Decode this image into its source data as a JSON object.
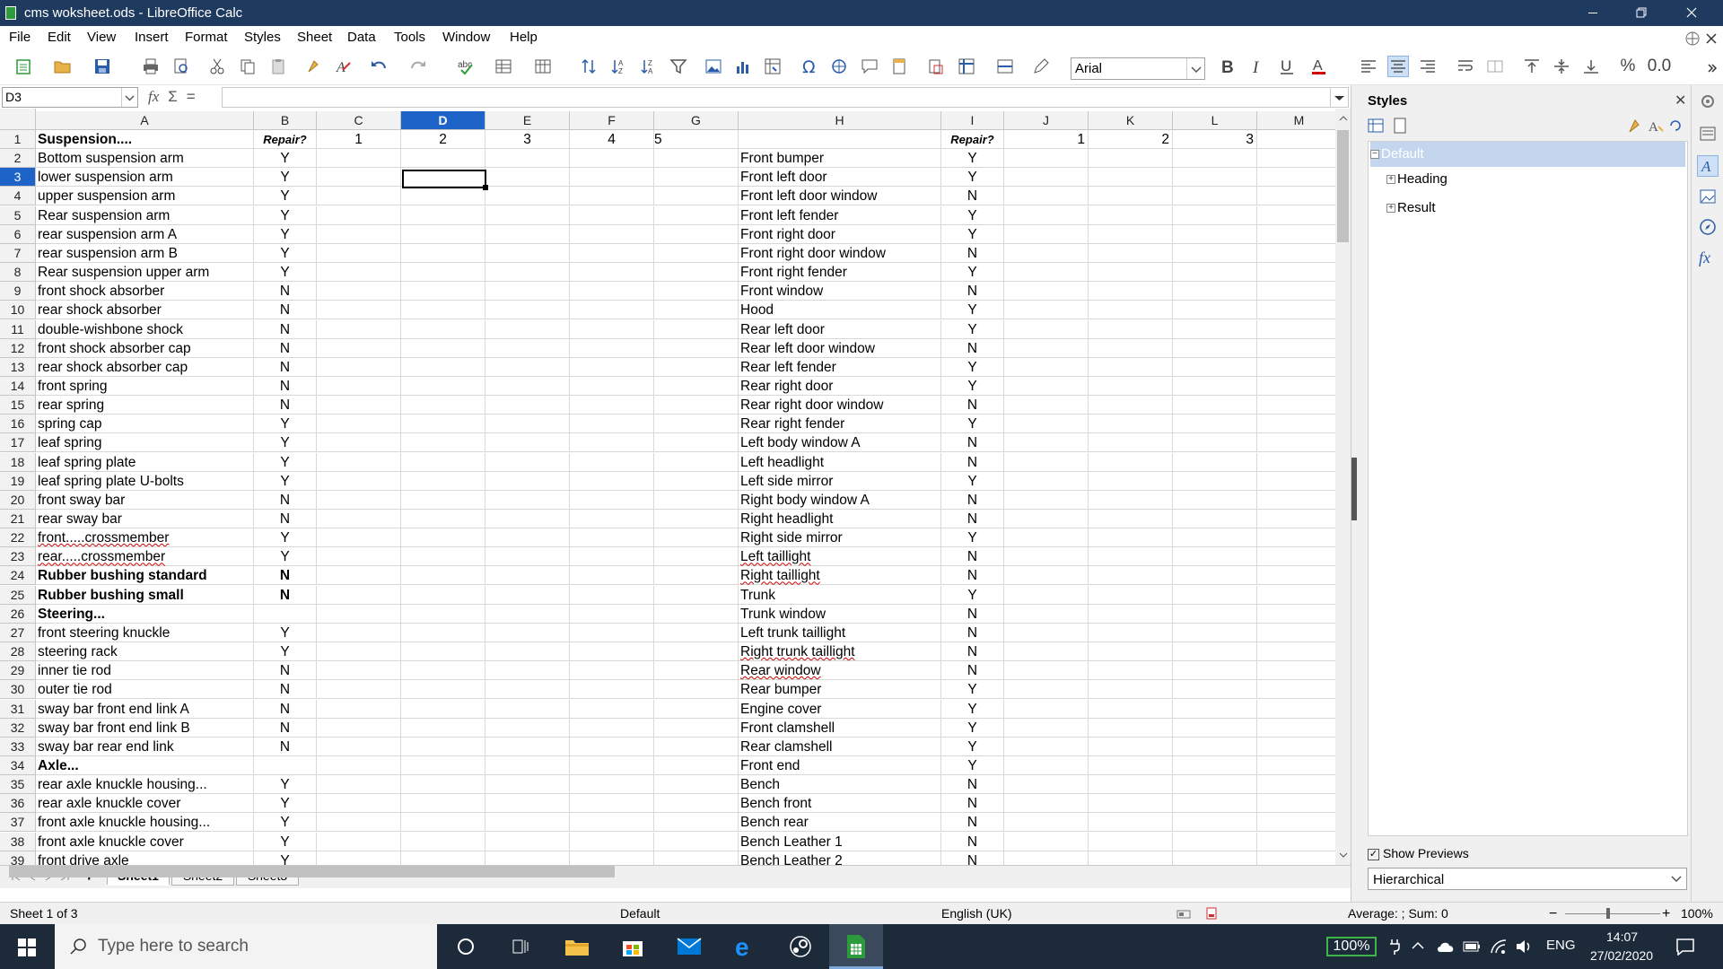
{
  "window": {
    "title": "cms woksheet.ods - LibreOffice Calc"
  },
  "menu": [
    "File",
    "Edit",
    "View",
    "Insert",
    "Format",
    "Styles",
    "Sheet",
    "Data",
    "Tools",
    "Window",
    "Help"
  ],
  "toolbar": {
    "font_name": "Arial",
    "percent_label": "%",
    "decimal_label": "0.0"
  },
  "formula_bar": {
    "cell_ref": "D3",
    "fx": "fx",
    "sigma": "Σ",
    "equals": "=",
    "content": ""
  },
  "columns": [
    "A",
    "B",
    "C",
    "D",
    "E",
    "F",
    "G",
    "H",
    "I",
    "J",
    "K",
    "L",
    "M"
  ],
  "selected_column": "D",
  "selected_row": 3,
  "rows": [
    {
      "n": 1,
      "a": "Suspension....",
      "b": "Repair?",
      "c": "1",
      "d": "2",
      "e": "3",
      "f": "4",
      "g": "5",
      "h": "",
      "i": "Repair?",
      "j": "1",
      "k": "2",
      "l": "3"
    },
    {
      "n": 2,
      "a": "Bottom suspension arm",
      "b": "Y",
      "h": "Front bumper",
      "i": "Y"
    },
    {
      "n": 3,
      "a": "lower suspension arm",
      "b": "Y",
      "h": "Front left door",
      "i": "Y"
    },
    {
      "n": 4,
      "a": "upper suspension arm",
      "b": "Y",
      "h": "Front left door window",
      "i": "N"
    },
    {
      "n": 5,
      "a": "Rear suspension arm",
      "b": "Y",
      "h": "Front left fender",
      "i": "Y"
    },
    {
      "n": 6,
      "a": "rear suspension arm A",
      "b": "Y",
      "h": "Front right door",
      "i": "Y"
    },
    {
      "n": 7,
      "a": "rear suspension arm B",
      "b": "Y",
      "h": "Front right door window",
      "i": "N"
    },
    {
      "n": 8,
      "a": "Rear suspension upper arm",
      "b": "Y",
      "h": "Front right fender",
      "i": "Y"
    },
    {
      "n": 9,
      "a": "front shock absorber",
      "b": "N",
      "h": "Front window",
      "i": "N"
    },
    {
      "n": 10,
      "a": "rear shock absorber",
      "b": "N",
      "h": "Hood",
      "i": "Y"
    },
    {
      "n": 11,
      "a": "double-wishbone shock",
      "b": "N",
      "h": "Rear left door",
      "i": "Y"
    },
    {
      "n": 12,
      "a": "front shock absorber cap",
      "b": "N",
      "h": "Rear left door window",
      "i": "N"
    },
    {
      "n": 13,
      "a": "rear shock absorber cap",
      "b": "N",
      "h": "Rear left fender",
      "i": "Y"
    },
    {
      "n": 14,
      "a": "front spring",
      "b": "N",
      "h": "Rear right door",
      "i": "Y"
    },
    {
      "n": 15,
      "a": "rear spring",
      "b": "N",
      "h": "Rear right door window",
      "i": "N"
    },
    {
      "n": 16,
      "a": "spring cap",
      "b": "Y",
      "h": "Rear right fender",
      "i": "Y"
    },
    {
      "n": 17,
      "a": "leaf spring",
      "b": "Y",
      "h": "Left body window A",
      "i": "N"
    },
    {
      "n": 18,
      "a": "leaf spring plate",
      "b": "Y",
      "h": "Left headlight",
      "i": "N"
    },
    {
      "n": 19,
      "a": "leaf spring plate U-bolts",
      "b": "Y",
      "h": "Left side mirror",
      "i": "Y"
    },
    {
      "n": 20,
      "a": "front sway bar",
      "b": "N",
      "h": "Right body window A",
      "i": "N"
    },
    {
      "n": 21,
      "a": "rear sway bar",
      "b": "N",
      "h": "Right headlight",
      "i": "N"
    },
    {
      "n": 22,
      "a": "front.....crossmember",
      "b": "Y",
      "h": "Right side mirror",
      "i": "Y"
    },
    {
      "n": 23,
      "a": "rear.....crossmember",
      "b": "Y",
      "h": "Left taillight",
      "i": "N"
    },
    {
      "n": 24,
      "a": "Rubber bushing standard",
      "b": "N",
      "h": "Right taillight",
      "i": "N",
      "bold": true
    },
    {
      "n": 25,
      "a": "Rubber bushing small",
      "b": "N",
      "h": "Trunk",
      "i": "Y",
      "bold": true
    },
    {
      "n": 26,
      "a": "Steering...",
      "b": "",
      "h": "Trunk window",
      "i": "N",
      "bold": true
    },
    {
      "n": 27,
      "a": "front steering knuckle",
      "b": "Y",
      "h": "Left trunk taillight",
      "i": "N"
    },
    {
      "n": 28,
      "a": "steering rack",
      "b": "Y",
      "h": "Right trunk taillight",
      "i": "N"
    },
    {
      "n": 29,
      "a": "inner tie rod",
      "b": "N",
      "h": "Rear window",
      "i": "N"
    },
    {
      "n": 30,
      "a": "outer tie rod",
      "b": "N",
      "h": "Rear bumper",
      "i": "Y"
    },
    {
      "n": 31,
      "a": "sway bar front end link A",
      "b": "N",
      "h": "Engine cover",
      "i": "Y"
    },
    {
      "n": 32,
      "a": "sway bar front end link B",
      "b": "N",
      "h": "Front clamshell",
      "i": "Y"
    },
    {
      "n": 33,
      "a": "sway bar rear end link",
      "b": "N",
      "h": "Rear clamshell",
      "i": "Y"
    },
    {
      "n": 34,
      "a": "Axle...",
      "b": "",
      "h": "Front end",
      "i": "Y",
      "bold": true
    },
    {
      "n": 35,
      "a": "rear axle knuckle housing...",
      "b": "Y",
      "h": "Bench",
      "i": "N"
    },
    {
      "n": 36,
      "a": "rear axle knuckle cover",
      "b": "Y",
      "h": "Bench front",
      "i": "N"
    },
    {
      "n": 37,
      "a": "front axle knuckle housing...",
      "b": "Y",
      "h": "Bench rear",
      "i": "N"
    },
    {
      "n": 38,
      "a": "front axle knuckle cover",
      "b": "Y",
      "h": "Bench Leather 1",
      "i": "N"
    },
    {
      "n": 39,
      "a": "front drive axle",
      "b": "Y",
      "h": "Bench Leather 2",
      "i": "N"
    }
  ],
  "sheets": [
    "Sheet1",
    "Sheet2",
    "Sheet3"
  ],
  "active_sheet": "Sheet1",
  "add_sheet": "+",
  "status": {
    "sheet_info": "Sheet 1 of 3",
    "page_style": "Default",
    "language": "English (UK)",
    "sum": "Average: ; Sum: 0",
    "zoom": "100%"
  },
  "sidebar": {
    "title": "Styles",
    "styles": [
      {
        "name": "Default",
        "expander": "−"
      },
      {
        "name": "Heading",
        "expander": "+"
      },
      {
        "name": "Result",
        "expander": "+"
      }
    ],
    "show_previews": "Show Previews",
    "filter": "Hierarchical"
  },
  "taskbar": {
    "search_placeholder": "Type here to search",
    "battery": "100%",
    "lang": "ENG",
    "time": "14:07",
    "date": "27/02/2020"
  },
  "colors": {
    "titlebar": "#1f3a5f",
    "selection": "#1e64c8",
    "taskbar": "#1c2a3a",
    "accent_green": "#2d9a3c"
  }
}
